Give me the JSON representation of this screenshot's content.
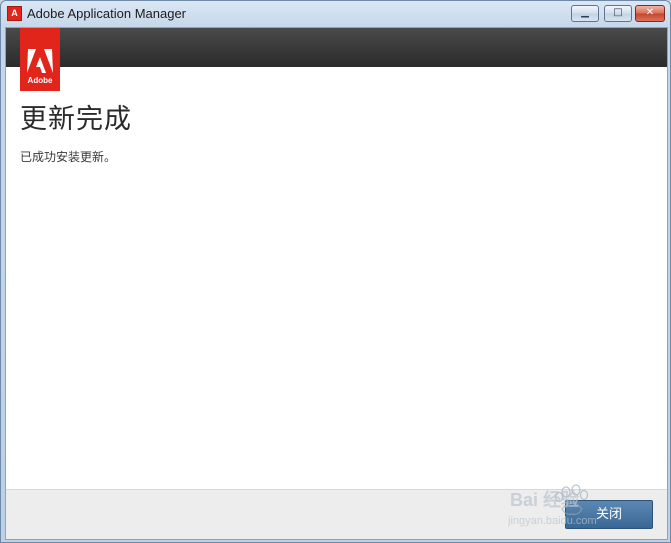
{
  "window": {
    "title": "Adobe Application Manager",
    "app_icon_glyph": "A",
    "controls": {
      "minimize": "▁",
      "maximize": "□",
      "close": "✕"
    }
  },
  "brand": {
    "logo_text": "Adobe",
    "color": "#e1251b"
  },
  "content": {
    "heading": "更新完成",
    "message": "已成功安装更新。"
  },
  "footer": {
    "close_button_label": "关闭"
  },
  "watermark": {
    "text_main": "Bai 经验",
    "text_sub": "jingyan.baidu.com"
  }
}
